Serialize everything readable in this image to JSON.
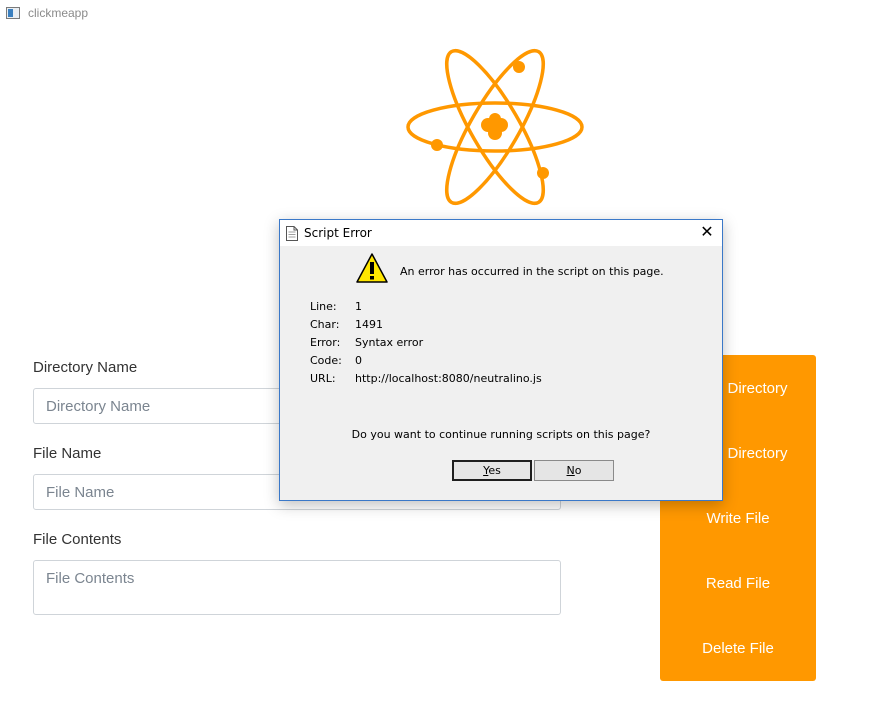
{
  "window": {
    "title": "clickmeapp",
    "icon": "app-window-icon"
  },
  "logo": {
    "icon": "atom-icon",
    "color": "#ff9800"
  },
  "form": {
    "directory_label": "Directory Name",
    "directory_placeholder": "Directory Name",
    "file_label": "File Name",
    "file_placeholder": "File Name",
    "contents_label": "File Contents",
    "contents_placeholder": "File Contents"
  },
  "actions": {
    "color": "#ff9800",
    "items": [
      {
        "label": "e Directory"
      },
      {
        "label": "e Directory"
      },
      {
        "label": "Write File"
      },
      {
        "label": "Read File"
      },
      {
        "label": "Delete File"
      }
    ]
  },
  "dialog": {
    "title": "Script Error",
    "message": "An error has occurred in the script on this page.",
    "fields": [
      {
        "key": "Line:",
        "value": "1"
      },
      {
        "key": "Char:",
        "value": "1491"
      },
      {
        "key": "Error:",
        "value": "Syntax error"
      },
      {
        "key": "Code:",
        "value": "0"
      },
      {
        "key": "URL:",
        "value": "http://localhost:8080/neutralino.js"
      }
    ],
    "question": "Do you want to continue running scripts on this page?",
    "yes_first": "Y",
    "yes_rest": "es",
    "no_first": "N",
    "no_rest": "o"
  }
}
